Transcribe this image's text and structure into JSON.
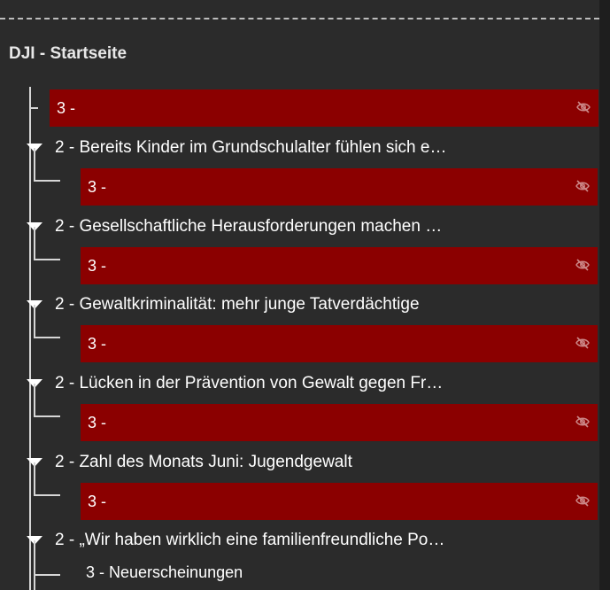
{
  "tree": {
    "root_label": "DJI - Startseite",
    "first_item": {
      "label": "3 -",
      "icon": "eye-slash-icon",
      "highlight": "#8b0000"
    },
    "groups": [
      {
        "label": "2 - Bereits Kinder im Grundschulalter fühlen sich e…",
        "child": {
          "label": "3 -",
          "icon": "eye-slash-icon"
        }
      },
      {
        "label": "2 - Gesellschaftliche Herausforderungen machen …",
        "child": {
          "label": "3 -",
          "icon": "eye-slash-icon"
        }
      },
      {
        "label": "2 - Gewaltkriminalität: mehr junge Tatverdächtige",
        "child": {
          "label": "3 -",
          "icon": "eye-slash-icon"
        }
      },
      {
        "label": "2 - Lücken in der Prävention von Gewalt gegen Fr…",
        "child": {
          "label": "3 -",
          "icon": "eye-slash-icon"
        }
      },
      {
        "label": "2 - Zahl des Monats Juni: Jugendgewalt",
        "child": {
          "label": "3 -",
          "icon": "eye-slash-icon"
        }
      },
      {
        "label": "2 - „Wir haben wirklich eine familienfreundliche Po…",
        "child": {
          "label": "3 - Neuerscheinungen"
        }
      }
    ]
  }
}
